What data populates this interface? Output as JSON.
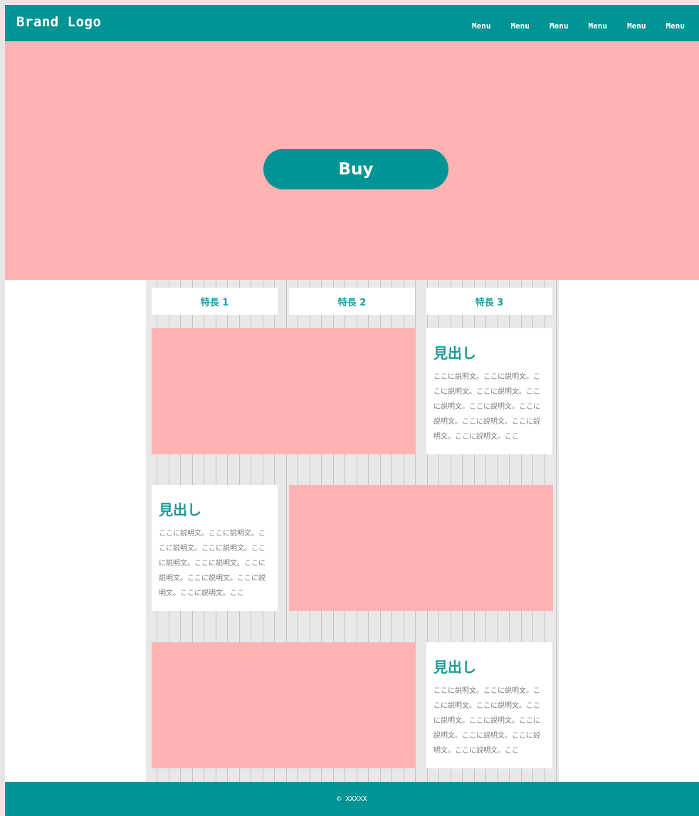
{
  "header": {
    "brand": "Brand Logo",
    "menu": [
      "Menu",
      "Menu",
      "Menu",
      "Menu",
      "Menu",
      "Menu"
    ]
  },
  "hero": {
    "button_label": "Buy"
  },
  "features": {
    "tabs": [
      "特長 1",
      "特長 2",
      "特長 3"
    ],
    "cards": [
      {
        "heading": "見出し",
        "text": "ここに説明文。ここに説明文。ここに説明文。ここに説明文。ここに説明文。ここに説明文。ここに説明文。ここに説明文。ここに説明文。ここに説明文。ここ"
      },
      {
        "heading": "見出し",
        "text": "ここに説明文。ここに説明文。ここに説明文。ここに説明文。ここに説明文。ここに説明文。ここに説明文。ここに説明文。ここに説明文。ここに説明文。ここ"
      },
      {
        "heading": "見出し",
        "text": "ここに説明文。ここに説明文。ここに説明文。ここに説明文。ここに説明文。ここに説明文。ここに説明文。ここに説明文。ここに説明文。ここに説明文。ここ"
      }
    ]
  },
  "footer": {
    "copyright": "© XXXXX"
  },
  "colors": {
    "primary": "#009494",
    "accent_pink": "#ffb3b3",
    "grid_bg": "#e8e8e8"
  }
}
